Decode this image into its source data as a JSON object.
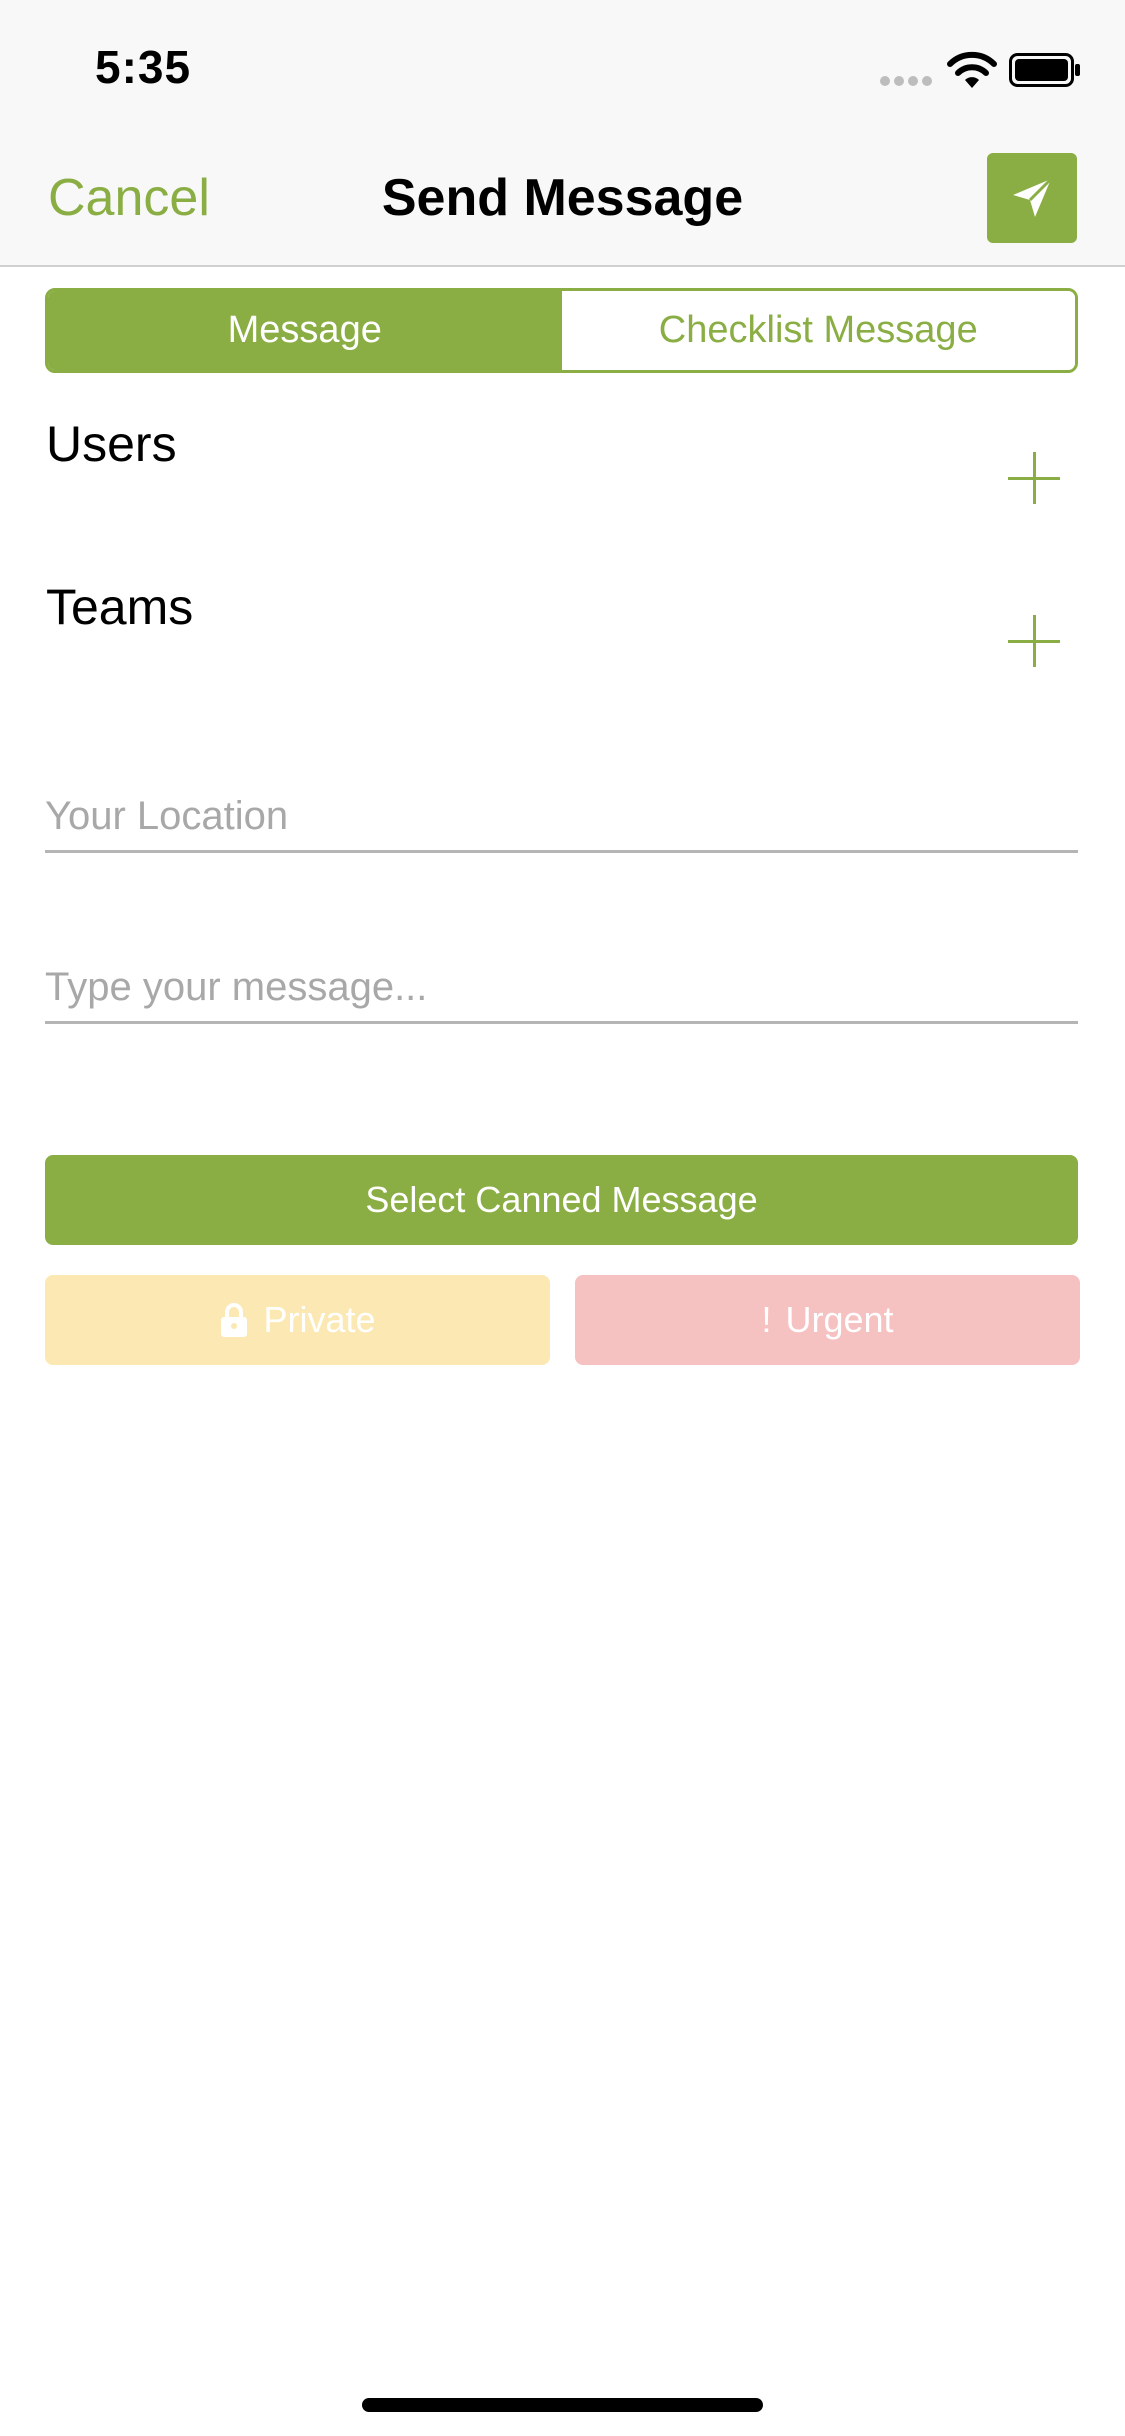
{
  "status_bar": {
    "time": "5:35"
  },
  "nav": {
    "cancel_label": "Cancel",
    "title": "Send Message",
    "send_icon": "paper-plane-icon"
  },
  "segments": [
    {
      "label": "Message",
      "selected": true
    },
    {
      "label": "Checklist Message",
      "selected": false
    }
  ],
  "recipients": {
    "users_label": "Users",
    "teams_label": "Teams"
  },
  "form": {
    "location_value": "",
    "location_placeholder": "Your Location",
    "message_value": "",
    "message_placeholder": "Type your message..."
  },
  "actions": {
    "canned_label": "Select Canned Message",
    "private_label": "Private",
    "urgent_icon_glyph": "!",
    "urgent_label": "Urgent"
  },
  "colors": {
    "accent": "#8aae44",
    "private": "#fce8b2",
    "urgent": "#f6c1c1"
  }
}
